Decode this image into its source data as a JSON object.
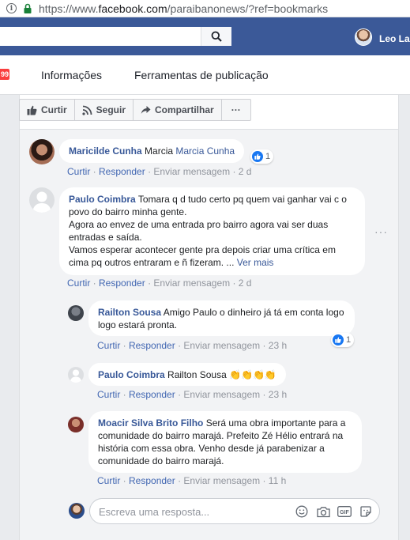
{
  "browser": {
    "url_prefix": "https://www.",
    "url_domain": "facebook.com",
    "url_rest": "/paraibanonews/?ref=bookmarks"
  },
  "topbar": {
    "user_name": "Leo La"
  },
  "subnav": {
    "badge": "99",
    "tabs": [
      "Informações",
      "Ferramentas de publicação"
    ]
  },
  "actions": {
    "like": "Curtir",
    "follow": "Seguir",
    "share": "Compartilhar",
    "more": "···"
  },
  "comments": [
    {
      "author": "Maricilde Cunha",
      "text_plain": "Marcia ",
      "tag": "Marcia Cunha",
      "links": [
        "Curtir",
        "Responder",
        "Enviar mensagem"
      ],
      "time": "2 d",
      "reactions": "1"
    },
    {
      "author": "Paulo Coimbra",
      "text": "Tomara q d tudo certo pq quem vai ganhar vai c o povo do bairro minha gente.",
      "text2": "Agora ao envez de uma entrada pro bairro agora vai ser duas entradas e saída.",
      "text3": "Vamos esperar acontecer gente pra depois criar uma crítica em cima pq outros entraram e ñ fizeram. ... ",
      "see_more": "Ver mais",
      "links": [
        "Curtir",
        "Responder",
        "Enviar mensagem"
      ],
      "time": "2 d",
      "replies": [
        {
          "author": "Railton Sousa",
          "text": "Amigo Paulo o dinheiro já tá em conta logo logo estará pronta.",
          "links": [
            "Curtir",
            "Responder",
            "Enviar mensagem"
          ],
          "time": "23 h",
          "reactions": "1"
        },
        {
          "author": "Paulo Coimbra",
          "text": "Railton Sousa ",
          "emoji": "👏👏👏👏",
          "links": [
            "Curtir",
            "Responder",
            "Enviar mensagem"
          ],
          "time": "23 h"
        },
        {
          "author": "Moacir Silva Brito Filho",
          "text": "Será uma obra importante para a comunidade do bairro marajá. Prefeito Zé Hélio entrará na história com essa obra. Venho desde já parabenizar a comunidade do bairro marajá.",
          "links": [
            "Curtir",
            "Responder",
            "Enviar mensagem"
          ],
          "time": "11 h"
        }
      ]
    }
  ],
  "reply_box": {
    "placeholder": "Escreva uma resposta..."
  },
  "colors": {
    "fb_blue": "#3b5998",
    "link": "#385898",
    "meta_link": "#4267b2"
  }
}
